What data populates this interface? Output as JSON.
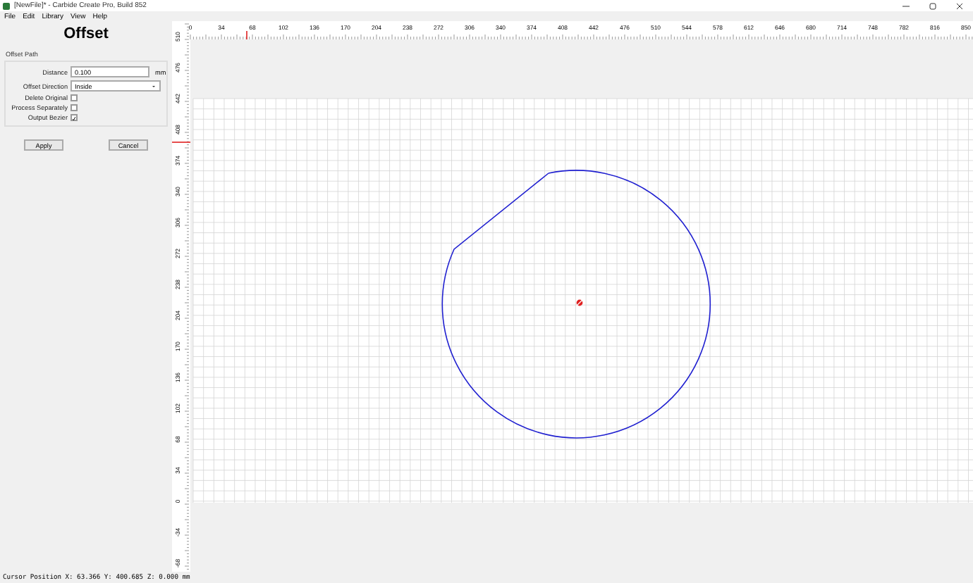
{
  "window": {
    "title": "[NewFile]* - Carbide Create Pro, Build 852"
  },
  "menu": [
    "File",
    "Edit",
    "Library",
    "View",
    "Help"
  ],
  "panel": {
    "heading": "Offset",
    "group_label": "Offset Path",
    "distance": {
      "label": "Distance",
      "value": "0.100",
      "unit": "mm"
    },
    "offset_direction": {
      "label": "Offset Direction",
      "value": "Inside"
    },
    "checkboxes": [
      {
        "label": "Delete Original",
        "checked": false
      },
      {
        "label": "Process Separately",
        "checked": false
      },
      {
        "label": "Output Bezier",
        "checked": true
      }
    ],
    "buttons": [
      "Apply",
      "Cancel"
    ]
  },
  "rulers": {
    "horizontal": [
      "0",
      "34",
      "68",
      "102",
      "136",
      "170",
      "204",
      "238",
      "272",
      "306",
      "340",
      "374",
      "408",
      "442",
      "476",
      "510",
      "544",
      "578",
      "612",
      "646",
      "680",
      "714",
      "748",
      "782",
      "816",
      "850"
    ],
    "vertical": [
      "510",
      "476",
      "442",
      "408",
      "374",
      "340",
      "306",
      "272",
      "238",
      "204",
      "170",
      "136",
      "102",
      "68",
      "34",
      "0",
      "-34",
      "-68"
    ]
  },
  "status_bar": "Cursor Position X: 63.366 Y: 400.685 Z: 0.000 mm"
}
